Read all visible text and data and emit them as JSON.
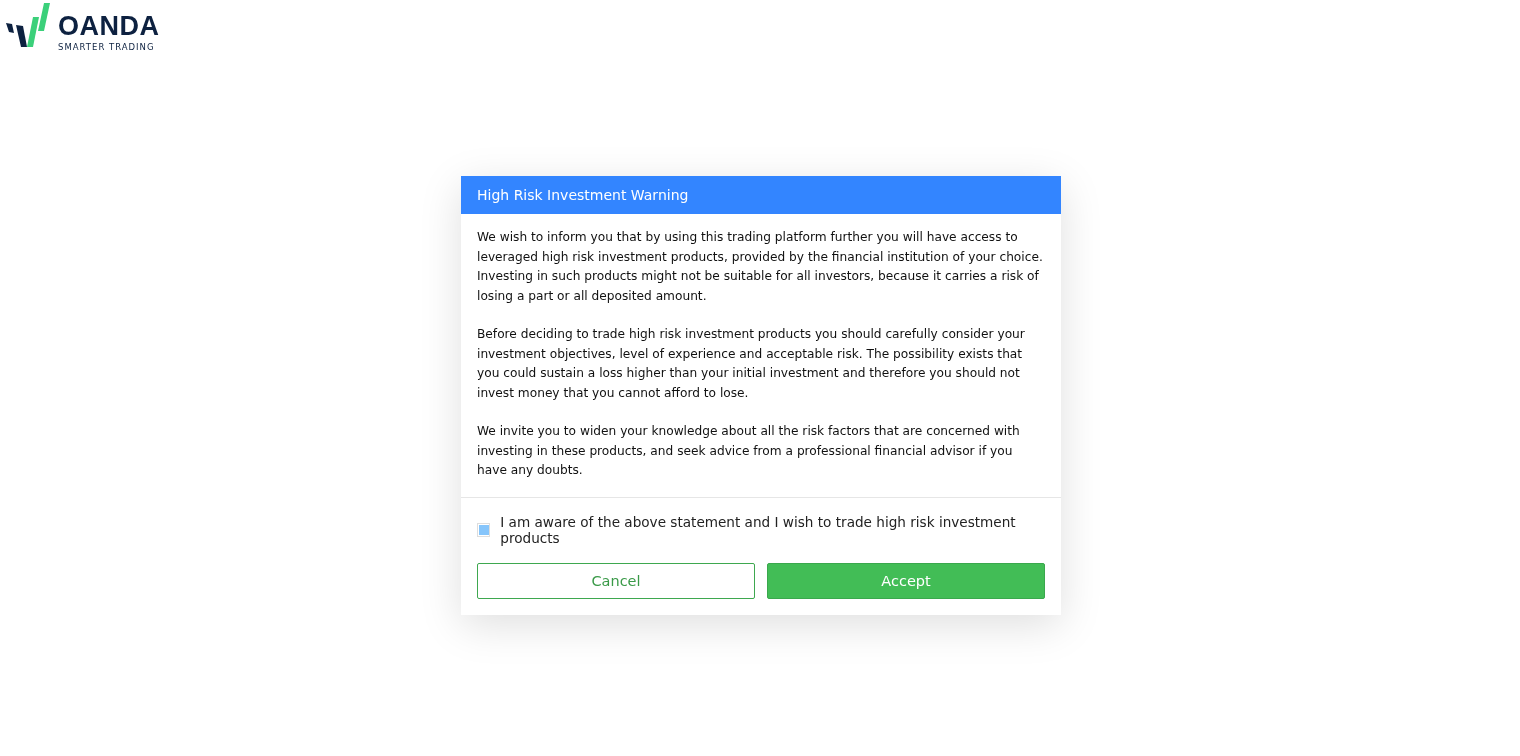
{
  "logo": {
    "name": "OANDA",
    "tagline": "SMARTER TRADING"
  },
  "dialog": {
    "title": "High Risk Investment Warning",
    "paragraphs": [
      "We wish to inform you that by using this trading platform further you will have access to leveraged high risk investment products, provided by the financial institution of your choice. Investing in such products might not be suitable for all investors, because it carries a risk of losing a part or all deposited amount.",
      "Before deciding to trade high risk investment products you should carefully consider your investment objectives, level of experience and acceptable risk. The possibility exists that you could sustain a loss higher than your initial investment and therefore you should not invest money that you cannot afford to lose.",
      "We invite you to widen your knowledge about all the risk factors that are concerned with investing in these products, and seek advice from a professional financial advisor if you have any doubts."
    ],
    "agreement": {
      "label": "I am aware of the above statement and I wish to trade high risk investment products",
      "checked": true
    },
    "buttons": [
      {
        "label": "Cancel",
        "kind": "outline"
      },
      {
        "label": "Accept",
        "kind": "primary"
      }
    ]
  }
}
